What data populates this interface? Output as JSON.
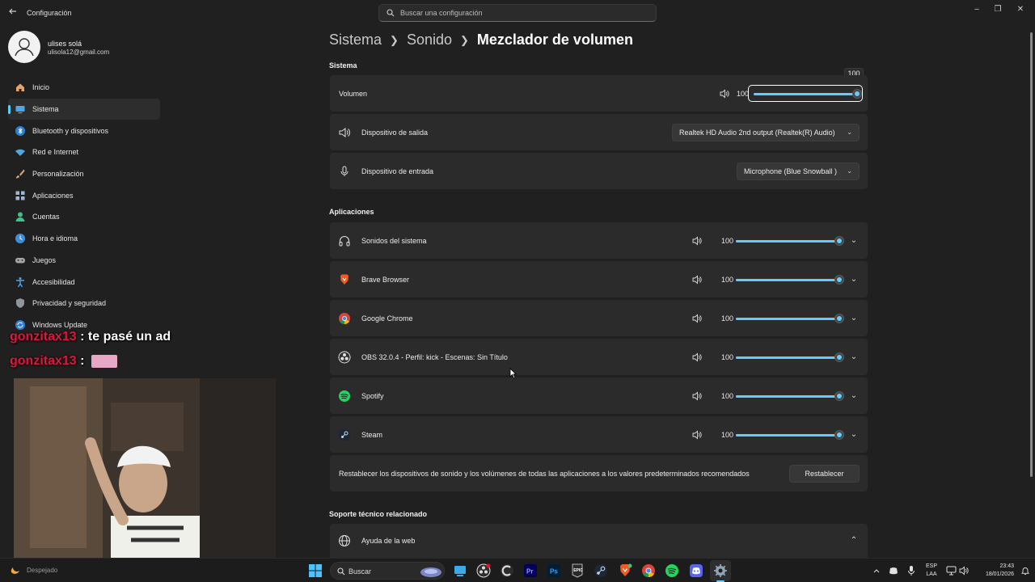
{
  "window": {
    "title": "Configuración",
    "search_placeholder": "Buscar una configuración"
  },
  "profile": {
    "name": "ulises solá",
    "email": "ulisola12@gmail.com"
  },
  "sidebar": {
    "items": [
      {
        "label": "Inicio",
        "icon": "home-icon"
      },
      {
        "label": "Sistema",
        "icon": "system-icon",
        "active": true
      },
      {
        "label": "Bluetooth y dispositivos",
        "icon": "bluetooth-icon"
      },
      {
        "label": "Red e Internet",
        "icon": "wifi-icon"
      },
      {
        "label": "Personalización",
        "icon": "brush-icon"
      },
      {
        "label": "Aplicaciones",
        "icon": "apps-icon"
      },
      {
        "label": "Cuentas",
        "icon": "person-icon"
      },
      {
        "label": "Hora e idioma",
        "icon": "globe-clock-icon"
      },
      {
        "label": "Juegos",
        "icon": "gamepad-icon"
      },
      {
        "label": "Accesibilidad",
        "icon": "accessibility-icon"
      },
      {
        "label": "Privacidad y seguridad",
        "icon": "shield-icon"
      },
      {
        "label": "Windows Update",
        "icon": "update-icon"
      }
    ]
  },
  "breadcrumb": {
    "part1": "Sistema",
    "part2": "Sonido",
    "current": "Mezclador de volumen"
  },
  "system_section": {
    "title": "Sistema",
    "volume_label": "Volumen",
    "volume_value": "100",
    "volume_level": 1.0,
    "tooltip": "100",
    "output_label": "Dispositivo de salida",
    "output_device": "Realtek HD Audio 2nd output (Realtek(R) Audio)",
    "input_label": "Dispositivo de entrada",
    "input_device": "Microphone (Blue Snowball )"
  },
  "apps_section": {
    "title": "Aplicaciones",
    "apps": [
      {
        "name": "Sonidos del sistema",
        "value": "100",
        "level": 1.0,
        "icon": "headphones-icon"
      },
      {
        "name": "Brave Browser",
        "value": "100",
        "level": 1.0,
        "icon": "brave-icon"
      },
      {
        "name": "Google Chrome",
        "value": "100",
        "level": 1.0,
        "icon": "chrome-icon"
      },
      {
        "name": "OBS 32.0.4 - Perfil: kick - Escenas: Sin Título",
        "value": "100",
        "level": 1.0,
        "icon": "obs-icon"
      },
      {
        "name": "Spotify",
        "value": "100",
        "level": 1.0,
        "icon": "spotify-icon"
      },
      {
        "name": "Steam",
        "value": "100",
        "level": 1.0,
        "icon": "steam-icon"
      }
    ],
    "reset_text": "Restablecer los dispositivos de sonido y los volúmenes de todas las aplicaciones a los valores predeterminados recomendados",
    "reset_button": "Restablecer"
  },
  "support_section": {
    "title": "Soporte técnico relacionado",
    "help_label": "Ayuda de la web"
  },
  "chat": {
    "line1_user": "gonzitax13",
    "line1_sep": " : ",
    "line1_msg": "te pasé un ad",
    "line2_user": "gonzitax13",
    "line2_sep": " : "
  },
  "taskbar": {
    "weather": "Despejado",
    "search": "Buscar",
    "lang_top": "ESP",
    "lang_bottom": "LAA",
    "time": "23:43",
    "date": "18/01/2026"
  },
  "colors": {
    "accent": "#60cdff",
    "chat_user": "#e0163f"
  }
}
